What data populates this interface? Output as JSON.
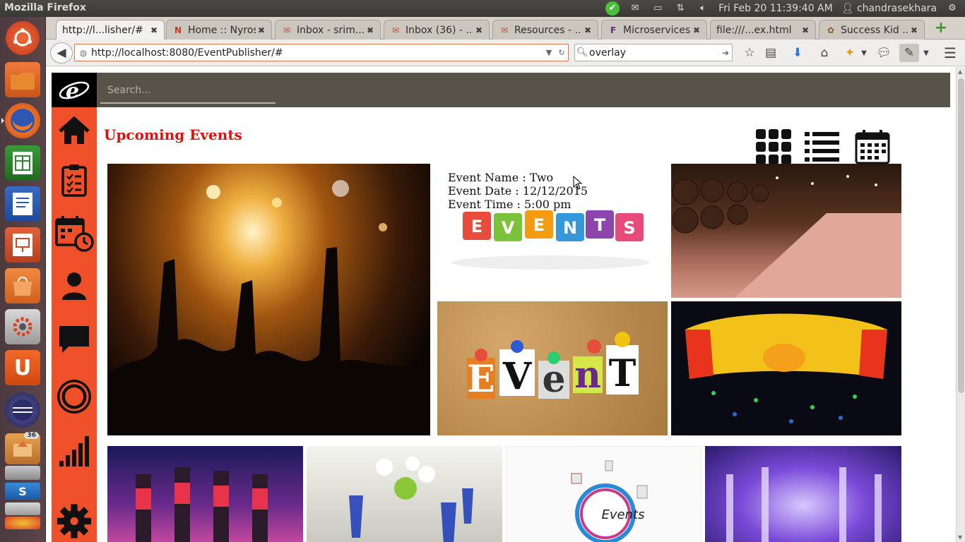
{
  "system": {
    "app_name": "Mozilla Firefox",
    "datetime": "Fri Feb 20 11:39:40 AM",
    "user": "chandrasekhara",
    "launcher_badge": "36"
  },
  "tabs": [
    {
      "label": "http://l...lisher/#",
      "icon": "page-icon",
      "active": true
    },
    {
      "label": "Home :: Nyros",
      "icon": "nyros-icon",
      "active": false
    },
    {
      "label": "Inbox - srim...",
      "icon": "gmail-icon",
      "active": false
    },
    {
      "label": "Inbox (36) - ...",
      "icon": "gmail-icon",
      "active": false
    },
    {
      "label": "Resources - ...",
      "icon": "gmail-icon",
      "active": false
    },
    {
      "label": "Microservices",
      "icon": "f-icon",
      "active": false
    },
    {
      "label": "file:///...ex.html",
      "icon": "",
      "active": false
    },
    {
      "label": "Success Kid ...",
      "icon": "success-icon",
      "active": false
    }
  ],
  "navbar": {
    "url": "http://localhost:8080/EventPublisher/#",
    "search_value": "overlay"
  },
  "app": {
    "search_placeholder": "Search...",
    "page_title": "Upcoming Events",
    "event": {
      "name_line": "Event Name : Two",
      "date_line": "Event Date : 12/12/2015",
      "time_line": "Event Time : 5:00 pm"
    },
    "tiles": {
      "events_blocks": [
        "E",
        "V",
        "E",
        "N",
        "T",
        "S"
      ],
      "cork_letters": [
        "E",
        "V",
        "e",
        "n",
        "T"
      ],
      "circle_label": "Events"
    }
  },
  "colors": {
    "sidebar": "#f05029",
    "header": "#585349",
    "title": "#e20f0f"
  }
}
